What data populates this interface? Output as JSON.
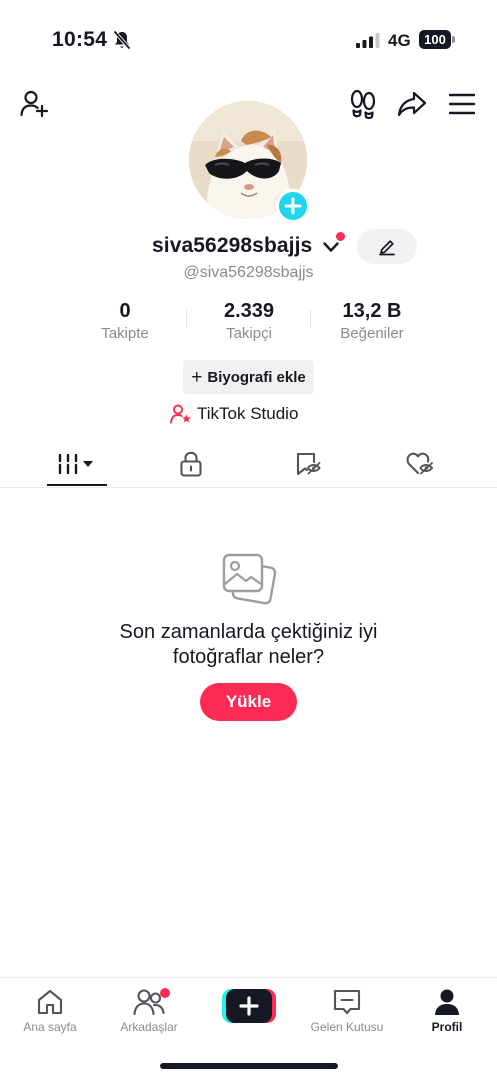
{
  "status_bar": {
    "time": "10:54",
    "network": "4G",
    "battery": "100",
    "icons": [
      "bell-off-icon",
      "signal-icon",
      "battery-icon"
    ]
  },
  "header": {
    "icons": [
      "add-friend-icon",
      "footprint-icon",
      "share-icon",
      "menu-icon"
    ]
  },
  "profile": {
    "username": "siva56298sbajjs",
    "handle": "@siva56298sbajjs",
    "avatar_description": "cat-with-sunglasses",
    "stats": [
      {
        "value": "0",
        "label": "Takipte"
      },
      {
        "value": "2.339",
        "label": "Takipçi"
      },
      {
        "value": "13,2 B",
        "label": "Beğeniler"
      }
    ],
    "bio_button": "Biyografi ekle",
    "bio_plus": "+",
    "studio_label": "TikTok Studio"
  },
  "tabs": [
    {
      "icon": "grid-icon",
      "active": true
    },
    {
      "icon": "lock-icon",
      "active": false
    },
    {
      "icon": "bookmark-icon",
      "active": false
    },
    {
      "icon": "liked-icon",
      "active": false
    }
  ],
  "empty_state": {
    "message_line1": "Son zamanlarda çektiğiniz iyi",
    "message_line2": "fotoğraflar neler?",
    "button": "Yükle"
  },
  "bottom_nav": [
    {
      "label": "Ana sayfa",
      "icon": "home-icon"
    },
    {
      "label": "Arkadaşlar",
      "icon": "friends-icon",
      "badge": true
    },
    {
      "label": "",
      "icon": "create-icon"
    },
    {
      "label": "Gelen Kutusu",
      "icon": "inbox-icon"
    },
    {
      "label": "Profil",
      "icon": "profile-icon",
      "active": true
    }
  ],
  "colors": {
    "accent": "#fe2c55",
    "cyan": "#20d5ec",
    "text": "#161823",
    "muted": "#8a8b91"
  }
}
